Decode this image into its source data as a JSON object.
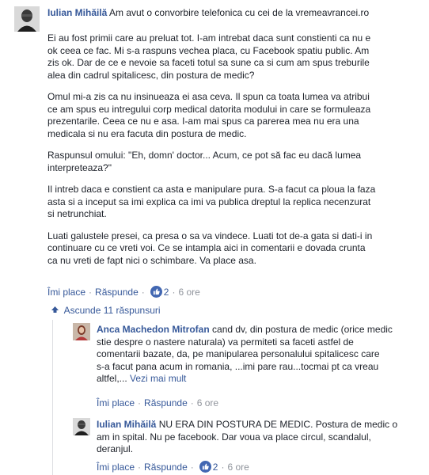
{
  "comment1": {
    "author": "Iulian Mihăilă",
    "first_line": "Am avut o convorbire telefonica cu cei de la vremeavrancei.ro",
    "paragraphs": [
      [
        "Ei au fost primii care au preluat tot. I-am intrebat daca sunt constienti ca nu e",
        "ok ceea ce fac. Mi s-a raspuns vechea placa, cu Facebook spatiu public. Am",
        "zis ok. Dar de ce e nevoie sa faceti totul sa sune ca si cum am spus treburile",
        "alea din cadrul spitalicesc, din postura de medic?"
      ],
      [
        "Omul mi-a zis ca nu insinueaza ei asa ceva. Il spun ca toata lumea va atribui",
        "ce am spus eu intregului corp medical datorita modului in care se formuleaza",
        "prezentarile. Ceea ce nu e asa. I-am mai spus ca parerea mea nu era una",
        "medicala si nu era facuta din postura de medic."
      ],
      [
        "Raspunsul omului: \"Eh, domn' doctor... Acum, ce pot să fac eu dacă lumea",
        "interpreteaza?\""
      ],
      [
        "Il intreb daca e constient ca asta e manipulare pura. S-a facut ca ploua la faza",
        "asta si a inceput sa imi explica ca imi va publica dreptul la replica necenzurat",
        "si netrunchiat."
      ],
      [
        "Luati galustele presei, ca presa o sa va vindece. Luati tot de-a gata si dati-i in",
        "continuare cu ce vreti voi. Ce se intampla aici in comentarii e dovada crunta",
        "ca nu vreti de fapt nici o schimbare. Va place asa."
      ]
    ],
    "like_label": "Îmi place",
    "reply_label": "Răspunde",
    "likes": "2",
    "time": "6 ore"
  },
  "replies_toggle": "Ascunde 11 răspunsuri",
  "reply1": {
    "author": "Anca Machedon Mitrofan",
    "lines": [
      "cand dv, din postura de medic (orice medic",
      "stie despre o nastere naturala) va permiteti sa faceti astfel de",
      "comentarii bazate, da, pe manipularea personalului spitalicesc care",
      "s-a facut pana acum in romania, ...imi pare rau...tocmai pt ca vreau",
      "altfel,..."
    ],
    "see_more": "Vezi mai mult",
    "like_label": "Îmi place",
    "reply_label": "Răspunde",
    "time": "6 ore"
  },
  "reply2": {
    "author": "Iulian Mihăilă",
    "lines": [
      "NU ERA DIN POSTURA DE MEDIC. Postura de medic o",
      "am in spital. Nu pe facebook. Dar voua va place circul, scandalul,",
      "deranjul."
    ],
    "like_label": "Îmi place",
    "reply_label": "Răspunde",
    "likes": "2",
    "time": "6 ore"
  },
  "colors": {
    "link": "#365899",
    "meta": "#90949c",
    "text": "#1d2129",
    "like": "#4267b2"
  },
  "icons": [
    "avatar-iulian",
    "avatar-anca",
    "thumbs-up-icon",
    "reply-arrow-icon"
  ]
}
